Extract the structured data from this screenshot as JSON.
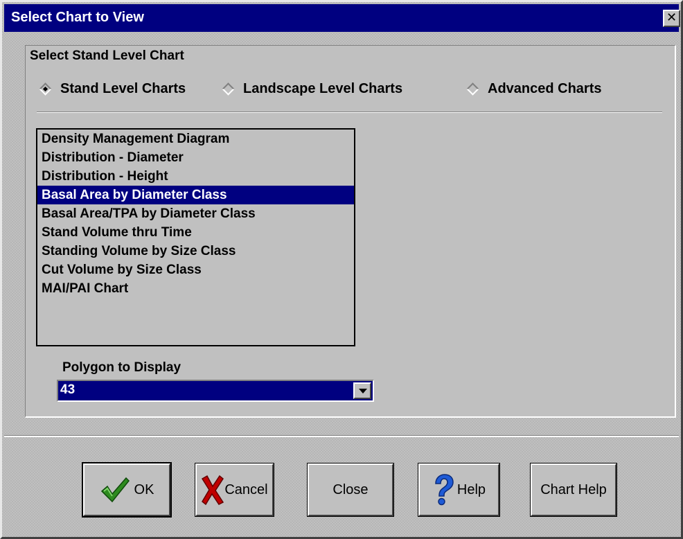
{
  "window": {
    "title": "Select Chart to View",
    "close_glyph": "✕"
  },
  "group": {
    "label": "Select Stand Level Chart"
  },
  "chart_levels": [
    {
      "label": "Stand Level Charts",
      "checked": true
    },
    {
      "label": "Landscape Level Charts",
      "checked": false
    },
    {
      "label": "Advanced Charts",
      "checked": false
    }
  ],
  "chart_list": {
    "items": [
      "Density Management Diagram",
      "Distribution - Diameter",
      "Distribution - Height",
      "Basal Area by Diameter Class",
      "Basal Area/TPA by Diameter Class",
      "Stand Volume thru Time",
      "Standing Volume by Size Class",
      "Cut Volume by Size Class",
      "MAI/PAI Chart"
    ],
    "selected_index": 3
  },
  "polygon": {
    "label": "Polygon to Display",
    "value": "43"
  },
  "buttons": {
    "ok": "OK",
    "cancel": "Cancel",
    "close": "Close",
    "help": "Help",
    "chart_help": "Chart Help"
  },
  "icons": {
    "ok": "checkmark-icon",
    "cancel": "red-x-icon",
    "help": "question-mark-icon",
    "dropdown": "chevron-down-icon"
  },
  "colors": {
    "title_bar": "#000080",
    "selection": "#000080",
    "face": "#c0c0c0",
    "ok_check": "#2e8b1f",
    "cancel_x": "#c00000",
    "help_q": "#1e5ad6"
  }
}
